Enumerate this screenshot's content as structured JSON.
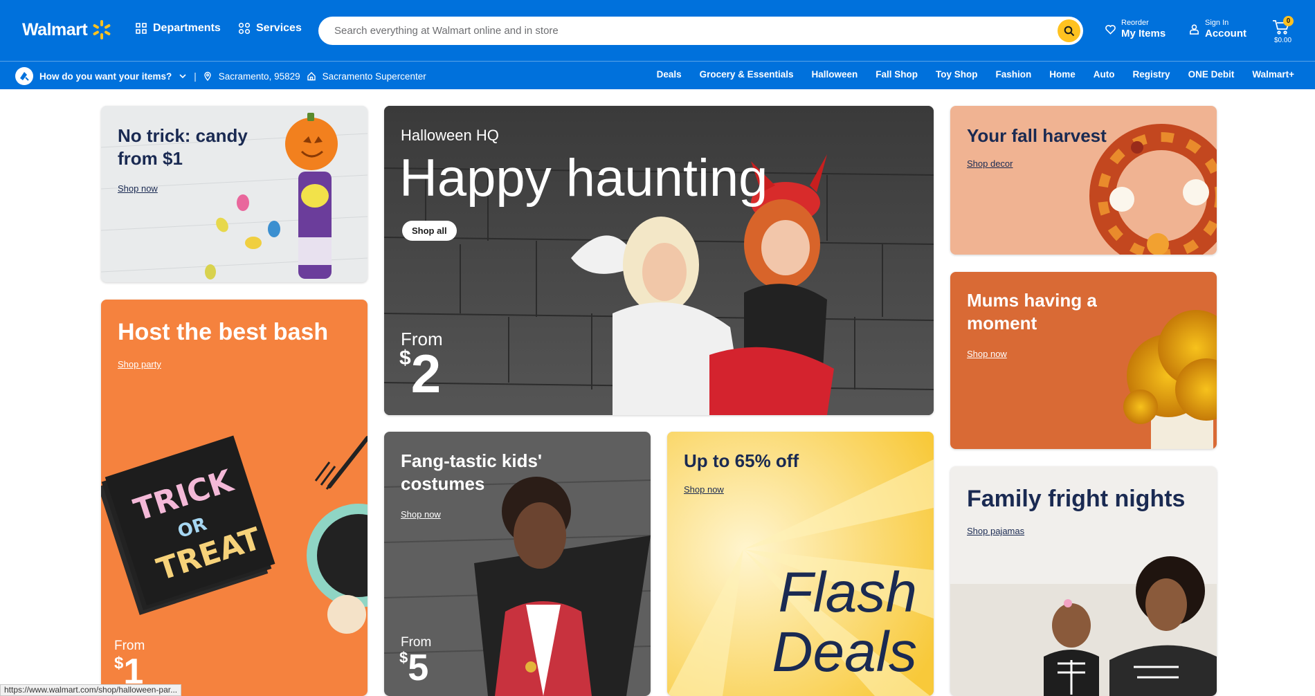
{
  "header": {
    "logo_text": "Walmart",
    "departments_label": "Departments",
    "services_label": "Services",
    "search_placeholder": "Search everything at Walmart online and in store",
    "reorder_small": "Reorder",
    "reorder_big": "My Items",
    "signin_small": "Sign In",
    "signin_big": "Account",
    "cart_count": "0",
    "cart_total": "$0.00"
  },
  "subbar": {
    "fulfillment_question": "How do you want your items?",
    "separator": "|",
    "location": "Sacramento, 95829",
    "store": "Sacramento Supercenter",
    "nav": [
      "Deals",
      "Grocery & Essentials",
      "Halloween",
      "Fall Shop",
      "Toy Shop",
      "Fashion",
      "Home",
      "Auto",
      "Registry",
      "ONE Debit",
      "Walmart+"
    ]
  },
  "tiles": {
    "candy": {
      "title": "No trick: candy from $1",
      "link": "Shop now"
    },
    "party": {
      "title": "Host the best bash",
      "link": "Shop party",
      "from_label": "From",
      "price_symbol": "$",
      "price": "1"
    },
    "hero": {
      "eyebrow": "Halloween HQ",
      "title": "Happy haunting",
      "button": "Shop all",
      "from_label": "From",
      "price_symbol": "$",
      "price": "2"
    },
    "costumes": {
      "title": "Fang-tastic kids' costumes",
      "link": "Shop now",
      "from_label": "From",
      "price_symbol": "$",
      "price": "5"
    },
    "flash": {
      "title": "Up to 65% off",
      "link": "Shop now",
      "big_line1": "Flash",
      "big_line2": "Deals"
    },
    "harvest": {
      "title": "Your fall harvest",
      "link": "Shop decor"
    },
    "mums": {
      "title": "Mums having a moment",
      "link": "Shop now"
    },
    "fright": {
      "title": "Family fright nights",
      "link": "Shop pajamas"
    }
  },
  "statusbar": {
    "url": "https://www.walmart.com/shop/halloween-par..."
  },
  "colors": {
    "brand_blue": "#0071dc",
    "spark_yellow": "#ffc220",
    "party_orange": "#f5823e",
    "harvest_peach": "#f0b392",
    "mums_orange": "#d96a35",
    "flash_yellow": "#fcd95a"
  }
}
